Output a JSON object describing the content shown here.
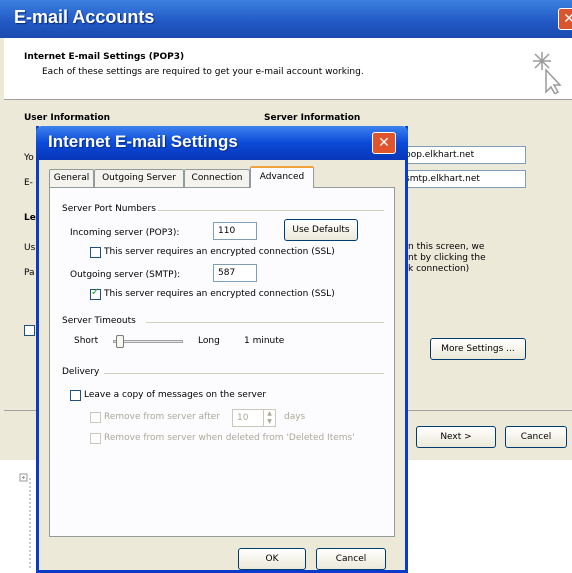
{
  "background_window": {
    "title": "E-mail Accounts",
    "close_glyph": "✕",
    "header_title": "Internet E-mail Settings (POP3)",
    "header_subtitle": "Each of these settings are required to get your e-mail account working.",
    "user_info_heading": "User Information",
    "server_info_heading": "Server Information",
    "incoming_server_value": "pop.elkhart.net",
    "outgoing_server_value": "smtp.elkhart.net",
    "truncated_labels": [
      "Yo",
      "E-",
      "Le",
      "Us",
      "Pa"
    ],
    "info_text_lines": [
      "n this screen, we",
      "nt by clicking the",
      "k connection)"
    ],
    "more_settings_label": "More Settings ...",
    "next_label": "Next >",
    "cancel_label": "Cancel"
  },
  "dialog": {
    "title": "Internet E-mail Settings",
    "close_glyph": "✕",
    "tabs": [
      {
        "label": "General",
        "active": false
      },
      {
        "label": "Outgoing Server",
        "active": false
      },
      {
        "label": "Connection",
        "active": false
      },
      {
        "label": "Advanced",
        "active": true
      }
    ],
    "server_port_numbers": {
      "heading": "Server Port Numbers",
      "incoming_label": "Incoming server (POP3):",
      "incoming_value": "110",
      "use_defaults_label": "Use Defaults",
      "incoming_ssl_label": "This server requires an encrypted connection (SSL)",
      "incoming_ssl_checked": false,
      "outgoing_label": "Outgoing server (SMTP):",
      "outgoing_value": "587",
      "outgoing_ssl_label": "This server requires an encrypted connection (SSL)",
      "outgoing_ssl_checked": true
    },
    "server_timeouts": {
      "heading": "Server Timeouts",
      "short_label": "Short",
      "long_label": "Long",
      "value_label": "1 minute"
    },
    "delivery": {
      "heading": "Delivery",
      "leave_copy_label": "Leave a copy of messages on the server",
      "leave_copy_checked": false,
      "remove_after_label": "Remove from server after",
      "remove_after_value": "10",
      "days_label": "days",
      "remove_deleted_label": "Remove from server when deleted from 'Deleted Items'"
    },
    "ok_label": "OK",
    "cancel_label": "Cancel"
  }
}
